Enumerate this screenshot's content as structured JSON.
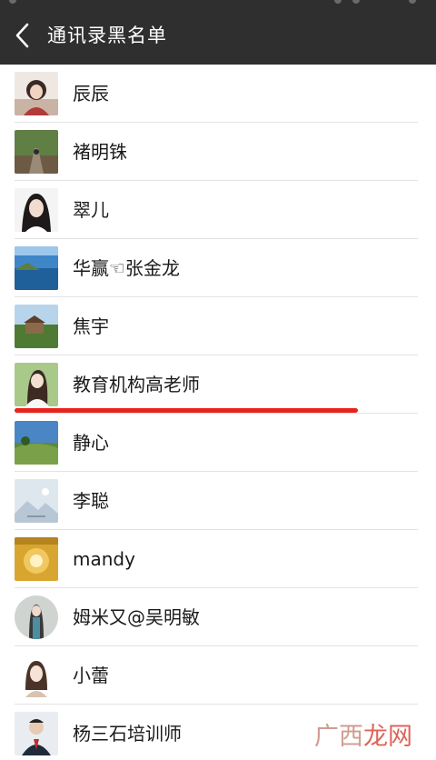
{
  "header": {
    "title": "通讯录黑名单",
    "back_icon": "chevron-left-icon",
    "background": "#2f2f2f"
  },
  "contacts": [
    {
      "name": "辰辰"
    },
    {
      "name": "褚明铢"
    },
    {
      "name": "翠儿"
    },
    {
      "name": "华赢☜张金龙"
    },
    {
      "name": "焦宇"
    },
    {
      "name": "教育机构高老师"
    },
    {
      "name": "静心"
    },
    {
      "name": "李聪"
    },
    {
      "name": "mandy"
    },
    {
      "name": "姆米又@吴明敏"
    },
    {
      "name": "小蕾"
    },
    {
      "name": "杨三石培训师"
    }
  ],
  "highlight": {
    "color": "#e8231b"
  },
  "watermark": {
    "text_a": "广西",
    "text_b": "龙网"
  }
}
